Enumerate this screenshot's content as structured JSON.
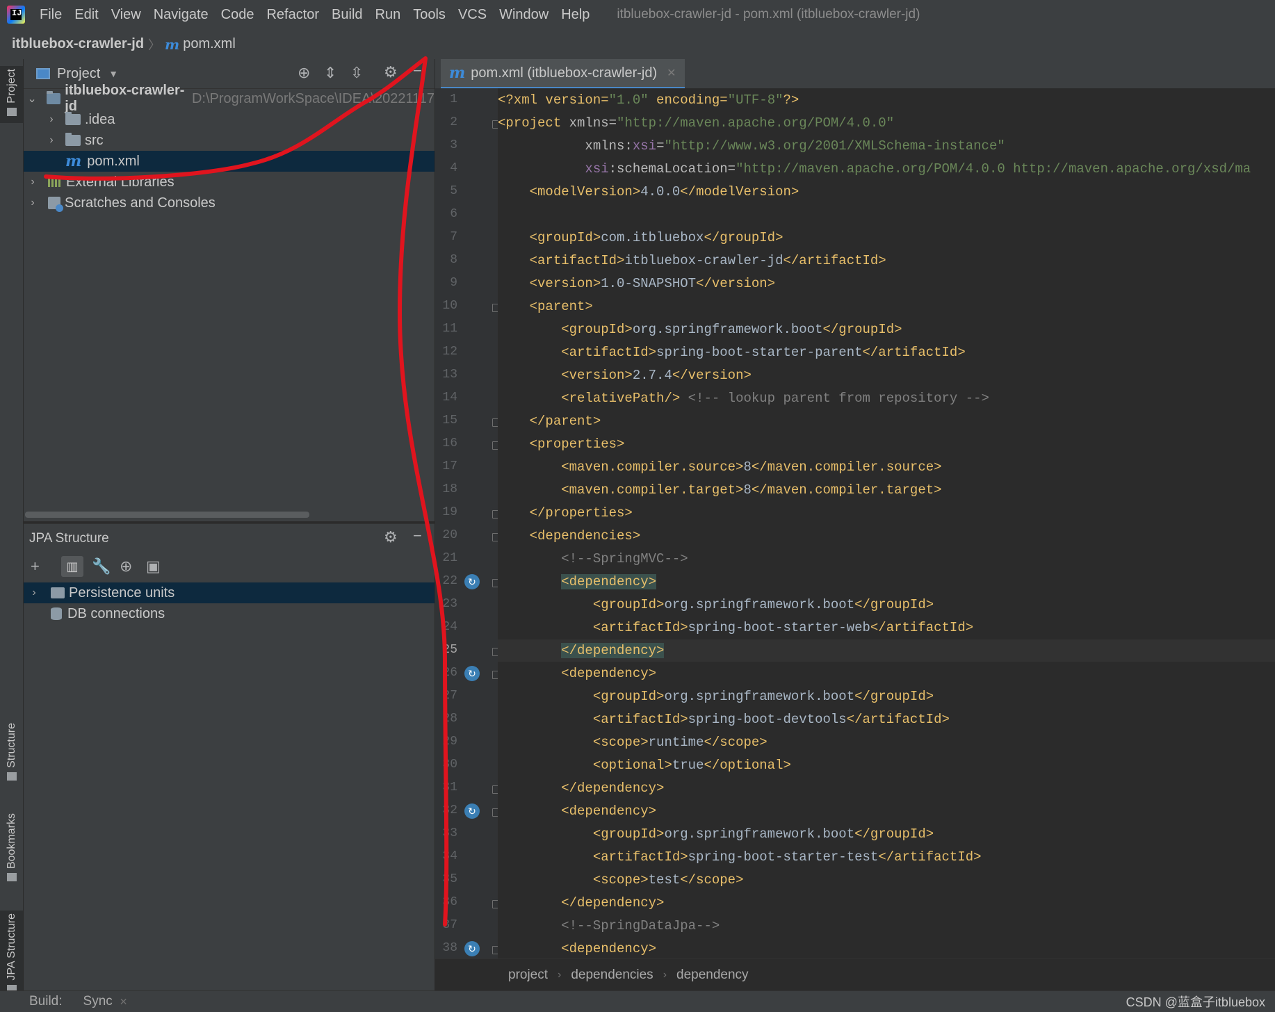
{
  "app": {
    "menu": [
      "File",
      "Edit",
      "View",
      "Navigate",
      "Code",
      "Refactor",
      "Build",
      "Run",
      "Tools",
      "VCS",
      "Window",
      "Help"
    ],
    "window_title": "itbluebox-crawler-jd - pom.xml (itbluebox-crawler-jd)"
  },
  "navbar": {
    "project": "itbluebox-crawler-jd",
    "file": "pom.xml",
    "file_icon": "m"
  },
  "stripe": {
    "project": "Project",
    "structure": "Structure",
    "bookmarks": "Bookmarks",
    "jpa_structure": "JPA Structure"
  },
  "project_panel": {
    "title": "Project",
    "tree": {
      "root": "itbluebox-crawler-jd",
      "root_path": "D:\\ProgramWorkSpace\\IDEA\\20221117",
      "idea": ".idea",
      "src": "src",
      "pom": "pom.xml",
      "external": "External Libraries",
      "scratches": "Scratches and Consoles"
    }
  },
  "jpa_panel": {
    "title": "JPA Structure",
    "persistence": "Persistence units",
    "db": "DB connections"
  },
  "editor": {
    "tab": "pom.xml (itbluebox-crawler-jd)",
    "line_numbers": [
      "1",
      "2",
      "3",
      "4",
      "5",
      "6",
      "7",
      "8",
      "9",
      "10",
      "11",
      "12",
      "13",
      "14",
      "15",
      "16",
      "17",
      "18",
      "19",
      "20",
      "21",
      "22",
      "23",
      "24",
      "25",
      "26",
      "27",
      "28",
      "29",
      "30",
      "31",
      "32",
      "33",
      "34",
      "35",
      "36",
      "37",
      "38"
    ],
    "lines": {
      "l1": {
        "a": "<?xml version=",
        "b": "\"1.0\"",
        "c": " encoding=",
        "d": "\"UTF-8\"",
        "e": "?>"
      },
      "l2": {
        "a": "<project ",
        "b": "xmlns=",
        "c": "\"http://maven.apache.org/POM/4.0.0\""
      },
      "l3": {
        "a": "xmlns:",
        "b": "xsi",
        "c": "=",
        "d": "\"http://www.w3.org/2001/XMLSchema-instance\""
      },
      "l4": {
        "a": "xsi",
        "b": ":schemaLocation=",
        "c": "\"http://maven.apache.org/POM/4.0.0 http://maven.apache.org/xsd/ma"
      },
      "l5": {
        "a": "<modelVersion>",
        "b": "4.0.0",
        "c": "</modelVersion>"
      },
      "l7": {
        "a": "<groupId>",
        "b": "com.itbluebox",
        "c": "</groupId>"
      },
      "l8": {
        "a": "<artifactId>",
        "b": "itbluebox-crawler-jd",
        "c": "</artifactId>"
      },
      "l9": {
        "a": "<version>",
        "b": "1.0-SNAPSHOT",
        "c": "</version>"
      },
      "l10": {
        "a": "<parent>"
      },
      "l11": {
        "a": "<groupId>",
        "b": "org.springframework.boot",
        "c": "</groupId>"
      },
      "l12": {
        "a": "<artifactId>",
        "b": "spring-boot-starter-parent",
        "c": "</artifactId>"
      },
      "l13": {
        "a": "<version>",
        "b": "2.7.4",
        "c": "</version>"
      },
      "l14": {
        "a": "<relativePath/>",
        "b": " <!-- lookup parent from repository -->"
      },
      "l15": {
        "a": "</parent>"
      },
      "l16": {
        "a": "<properties>"
      },
      "l17": {
        "a": "<maven.compiler.source>",
        "b": "8",
        "c": "</maven.compiler.source>"
      },
      "l18": {
        "a": "<maven.compiler.target>",
        "b": "8",
        "c": "</maven.compiler.target>"
      },
      "l19": {
        "a": "</properties>"
      },
      "l20": {
        "a": "<dependencies>"
      },
      "l21": {
        "a": "<!--SpringMVC-->"
      },
      "l22": {
        "a": "<dependency>"
      },
      "l23": {
        "a": "<groupId>",
        "b": "org.springframework.boot",
        "c": "</groupId>"
      },
      "l24": {
        "a": "<artifactId>",
        "b": "spring-boot-starter-web",
        "c": "</artifactId>"
      },
      "l25": {
        "a": "</dependency>"
      },
      "l26": {
        "a": "<dependency>"
      },
      "l27": {
        "a": "<groupId>",
        "b": "org.springframework.boot",
        "c": "</groupId>"
      },
      "l28": {
        "a": "<artifactId>",
        "b": "spring-boot-devtools",
        "c": "</artifactId>"
      },
      "l29": {
        "a": "<scope>",
        "b": "runtime",
        "c": "</scope>"
      },
      "l30": {
        "a": "<optional>",
        "b": "true",
        "c": "</optional>"
      },
      "l31": {
        "a": "</dependency>"
      },
      "l32": {
        "a": "<dependency>"
      },
      "l33": {
        "a": "<groupId>",
        "b": "org.springframework.boot",
        "c": "</groupId>"
      },
      "l34": {
        "a": "<artifactId>",
        "b": "spring-boot-starter-test",
        "c": "</artifactId>"
      },
      "l35": {
        "a": "<scope>",
        "b": "test",
        "c": "</scope>"
      },
      "l36": {
        "a": "</dependency>"
      },
      "l37": {
        "a": "<!--SpringDataJpa-->"
      },
      "l38": {
        "a": "<dependency>"
      }
    }
  },
  "breadcrumb": [
    "project",
    "dependencies",
    "dependency"
  ],
  "bottom": {
    "build": "Build:",
    "sync": "Sync",
    "watermark": "CSDN @蓝盒子itbluebox"
  },
  "colors": {
    "annotation": "#e0141e",
    "tag": "#e8bf6a",
    "string": "#6a8759",
    "comment": "#808080",
    "selection": "#0d293e"
  }
}
